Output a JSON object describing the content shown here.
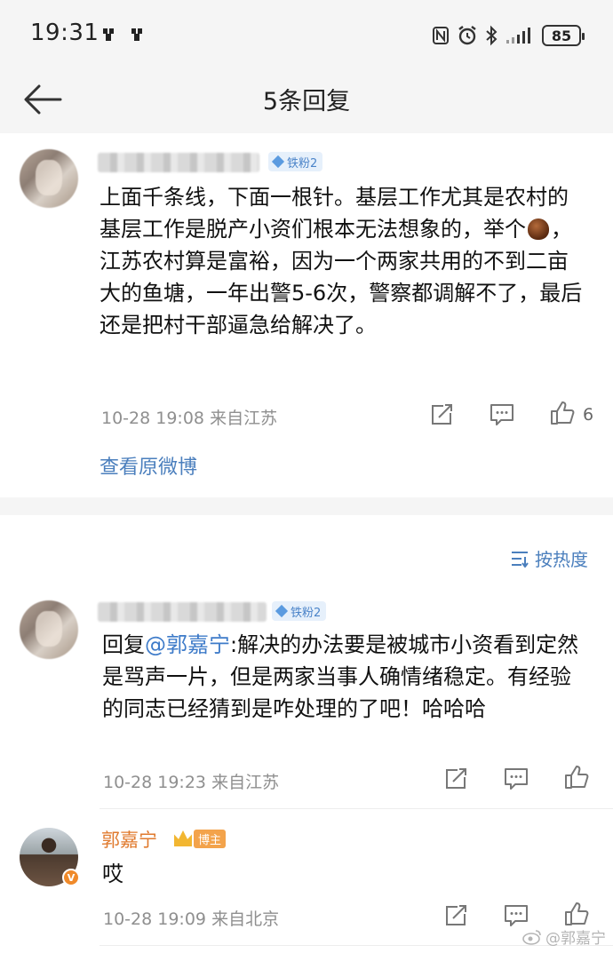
{
  "status_bar": {
    "time": "19:31",
    "battery": "85",
    "icons": [
      "app-icon",
      "app-icon",
      "nfc-icon",
      "alarm-icon",
      "bluetooth-icon",
      "signal-icon",
      "battery-icon"
    ]
  },
  "nav": {
    "title": "5条回复",
    "back_icon": "back-arrow-icon"
  },
  "main_comment": {
    "badge": "铁粉2",
    "text_before_emoji": "上面千条线，下面一根针。基层工作尤其是农村的基层工作是脱产小资们根本无法想象的，举个",
    "emoji": "chestnut",
    "text_after_emoji": "，江苏农村算是富裕，因为一个两家共用的不到二亩大的鱼塘，一年出警5-6次，警察都调解不了，最后还是把村干部逼急给解决了。",
    "time": "10-28 19:08",
    "source": "来自江苏",
    "like_count": "6",
    "view_original": "查看原微博"
  },
  "sort": {
    "label": "按热度"
  },
  "replies": [
    {
      "badge": "铁粉2",
      "reply_prefix": "回复",
      "mention": "@郭嘉宁",
      "text": ":解决的办法要是被城市小资看到定然是骂声一片，但是两家当事人确情绪稳定。有经验的同志已经猜到是咋处理的了吧！哈哈哈",
      "time": "10-28 19:23",
      "source": "来自江苏"
    },
    {
      "name": "郭嘉宁",
      "host_label": "博主",
      "text": "哎",
      "time": "10-28 19:09",
      "source": "来自北京"
    }
  ],
  "watermark": "@郭嘉宁",
  "colors": {
    "link": "#4b7fbd",
    "author_name": "#e07a2e",
    "meta": "#8f8f8f",
    "background": "#f5f5f5"
  }
}
